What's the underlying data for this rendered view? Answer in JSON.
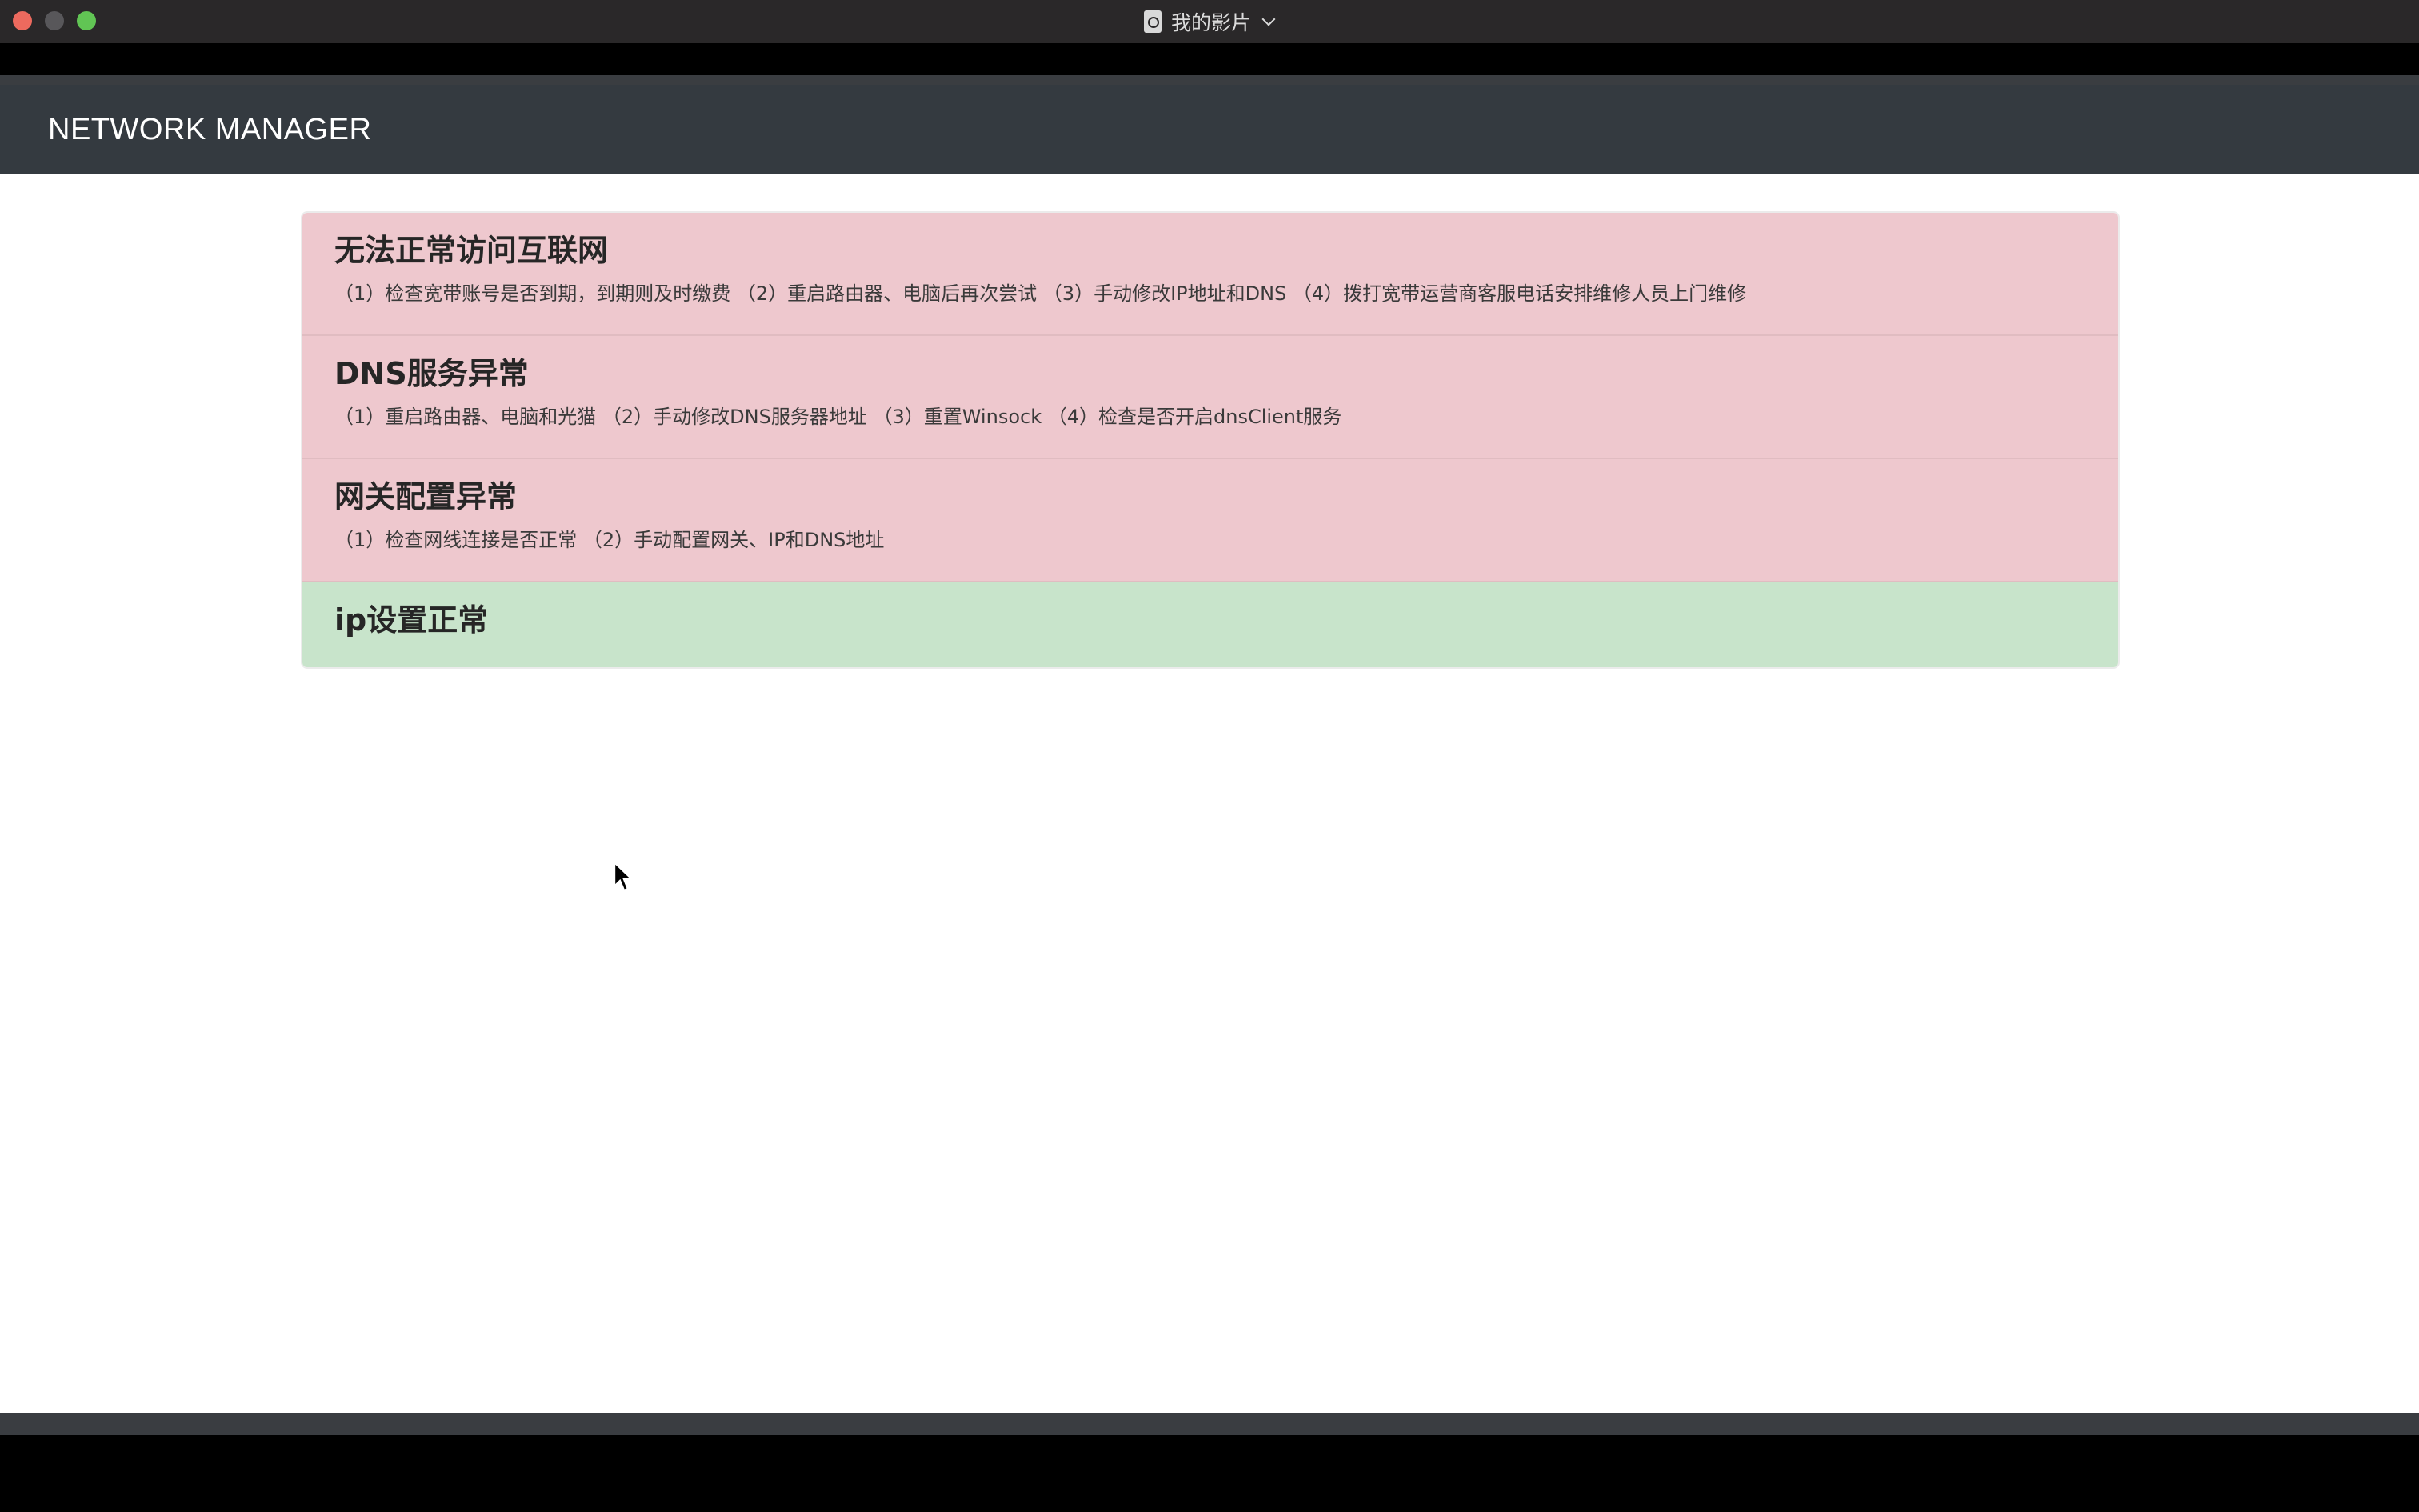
{
  "window": {
    "title": "我的影片"
  },
  "app": {
    "brand": "NETWORK MANAGER"
  },
  "issues": [
    {
      "status": "danger",
      "title": "无法正常访问互联网",
      "description": "（1）检查宽带账号是否到期，到期则及时缴费 （2）重启路由器、电脑后再次尝试 （3）手动修改IP地址和DNS （4）拨打宽带运营商客服电话安排维修人员上门维修"
    },
    {
      "status": "danger",
      "title": "DNS服务异常",
      "description": "（1）重启路由器、电脑和光猫 （2）手动修改DNS服务器地址 （3）重置Winsock （4）检查是否开启dnsClient服务"
    },
    {
      "status": "danger",
      "title": "网关配置异常",
      "description": "（1）检查网线连接是否正常 （2）手动配置网关、IP和DNS地址"
    },
    {
      "status": "success",
      "title": "ip设置正常"
    }
  ],
  "colors": {
    "danger_bg": "#eec8ce",
    "success_bg": "#c8e4cb",
    "navbar_bg": "#343a40"
  },
  "icons": {
    "window_controls": [
      "close-icon",
      "minimize-icon",
      "maximize-icon"
    ],
    "title": "document-icon",
    "title_menu": "chevron-down-icon",
    "pointer": "mouse-cursor-icon"
  }
}
